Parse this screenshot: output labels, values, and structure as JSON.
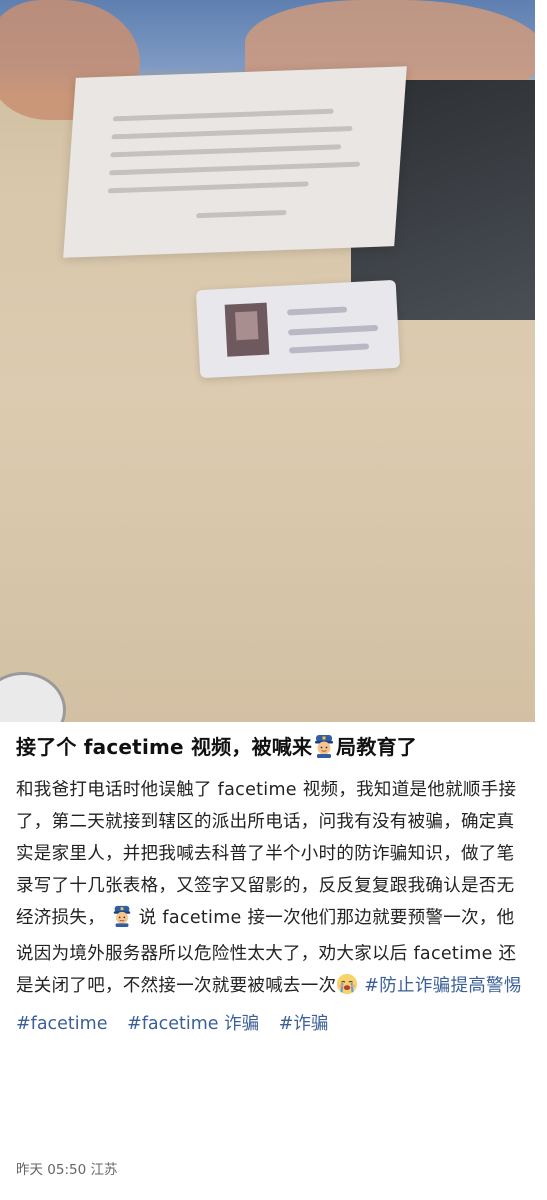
{
  "post": {
    "title_text": "接了个 facetime 视频，被喊来",
    "title_emoji": "police-officer",
    "title_suffix": "局教育了",
    "body_part1": "和我爸打电话时他误触了 facetime 视频，我知道是他就顺手接了，第二天就接到辖区的派出所电话，问我有没有被骗，确定真实是家里人，并把我喊去科普了半个小时的防诈骗知识，做了笔录写了十几张表格，又签字又留影的，反反复复跟我确认是否无经济损失，",
    "body_part2": "说 facetime 接一次他们那边就要预警一次，他说因为境外服务器所以危险性太大了，劝大家以后 facetime 还是关闭了吧，不然接一次就要被喊去一次",
    "inline_hashtag": "#防止诈骗提高警惕",
    "hashtags": [
      "#facetime",
      "#facetime 诈骗",
      "#诈骗"
    ],
    "time": "昨天 05:50",
    "location": "江苏"
  },
  "colors": {
    "hashtag": "#3b5f97",
    "text": "#222222",
    "meta": "#666666"
  }
}
